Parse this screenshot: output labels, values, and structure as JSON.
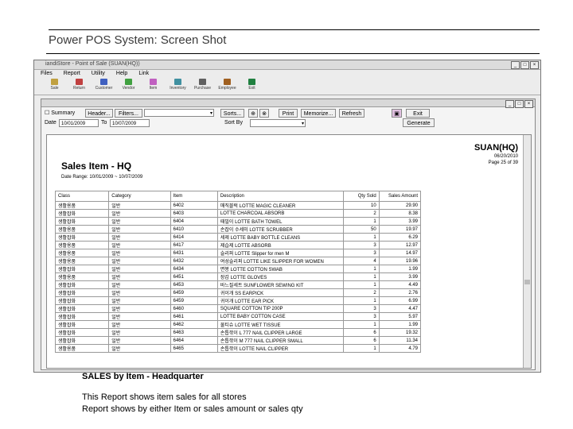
{
  "slide": {
    "title": "Power POS System: Screen Shot",
    "caption": "SALES by Item - Headquarter",
    "desc1": "This Report shows item sales for all stores",
    "desc2": "Report shows by either Item or sales amount or sales qty"
  },
  "window": {
    "title": "iandiStore - Point of Sale (SUAN(HQ))"
  },
  "menu": [
    "Files",
    "Report",
    "Utility",
    "Help",
    "Link"
  ],
  "toolbar": [
    {
      "label": "Sale",
      "color": "#c0a040"
    },
    {
      "label": "Return",
      "color": "#c04040"
    },
    {
      "label": "Customer",
      "color": "#4060c0"
    },
    {
      "label": "Vendor",
      "color": "#40a040"
    },
    {
      "label": "Item",
      "color": "#c060c0"
    },
    {
      "label": "Inventory",
      "color": "#4090a0"
    },
    {
      "label": "Purchase",
      "color": "#606060"
    },
    {
      "label": "Employee",
      "color": "#a06020"
    },
    {
      "label": "Exit",
      "color": "#208040"
    }
  ],
  "child": {
    "summary_label": "Summary",
    "header_btn": "Header...",
    "filters_btn": "Filters...",
    "sorts_btn": "Sorts...",
    "print_btn": "Print",
    "memorize_btn": "Memorize...",
    "refresh_btn": "Refresh",
    "exit_btn": "Exit",
    "generate_btn": "Generate",
    "date_label": "Date",
    "date_from": "10/01/2009",
    "to_label": "To",
    "date_to": "10/07/2009",
    "sort_by_label": "Sort By"
  },
  "report": {
    "store": "SUAN(HQ)",
    "date": "06/20/2010",
    "page": "Page 25 of 39",
    "title": "Sales Item - HQ",
    "date_range": "Date Range:  10/01/2009  ~  10/07/2009",
    "columns": [
      "Class",
      "Category",
      "Item",
      "Description",
      "Qty Sold",
      "Sales Amount"
    ],
    "rows": [
      [
        "생활용품",
        "일반",
        "6402",
        "매직블럭 LOTTE MAGIC CLEANER",
        "10",
        "29.90"
      ],
      [
        "생활잡화",
        "일반",
        "6403",
        "LOTTE CHARCOAL ABSORB",
        "2",
        "8.38"
      ],
      [
        "생활잡화",
        "일반",
        "6404",
        "때밀이 LOTTE BATH TOWEL",
        "1",
        "3.99"
      ],
      [
        "생활용품",
        "일반",
        "6410",
        "손잡이 수세미 LOTTE SCRUBBER",
        "50",
        "19.97"
      ],
      [
        "생활잡화",
        "일반",
        "6414",
        "세제 LOTTE BABY BOTTLE CLEANS",
        "1",
        "6.29"
      ],
      [
        "생활용품",
        "일반",
        "6417",
        "제습제 LOTTE ABSORB",
        "3",
        "12.97"
      ],
      [
        "생활용품",
        "일반",
        "6431",
        "슬리퍼 LOTTE Slipper for men M",
        "3",
        "14.97"
      ],
      [
        "생활용품",
        "일반",
        "6432",
        "여성슬리퍼 LOTTE LIKE SLIPPER FOR WOMEN",
        "4",
        "19.96"
      ],
      [
        "생활잡화",
        "일반",
        "6434",
        "면봉 LOTTE COTTON SWAB",
        "1",
        "1.99"
      ],
      [
        "생활용품",
        "일반",
        "6451",
        "장갑 LOTTE GLOVES",
        "1",
        "3.99"
      ],
      [
        "생활잡화",
        "일반",
        "6453",
        "바느질세트 SUNFLOWER SEWING KIT",
        "1",
        "4.49"
      ],
      [
        "생활잡화",
        "일반",
        "6459",
        "귀이개 SS EARPICK",
        "2",
        "2.76"
      ],
      [
        "생활잡화",
        "일반",
        "6459",
        "귀이개 LOTTE EAR PICK",
        "1",
        "6.99"
      ],
      [
        "생활잡화",
        "일반",
        "6460",
        "SQUARE COTTON TIP 200P",
        "3",
        "4.47"
      ],
      [
        "생활잡화",
        "일반",
        "6461",
        "LOTTE BABY COTTON CASE",
        "3",
        "5.97"
      ],
      [
        "생활잡화",
        "일반",
        "6462",
        "물티슈 LOTTE WET TISSUE",
        "1",
        "1.99"
      ],
      [
        "생활잡화",
        "일반",
        "6463",
        "손톱깎이 L 777 NAIL CLIPPER LARGE",
        "6",
        "19.32"
      ],
      [
        "생활잡화",
        "일반",
        "6464",
        "손톱깎이 M 777 NAIL CLIPPER SMALL",
        "6",
        "11.34"
      ],
      [
        "생활용품",
        "일반",
        "6465",
        "손톱깎이 LOTTE NAIL CLIPPER",
        "1",
        "4.79"
      ]
    ]
  }
}
